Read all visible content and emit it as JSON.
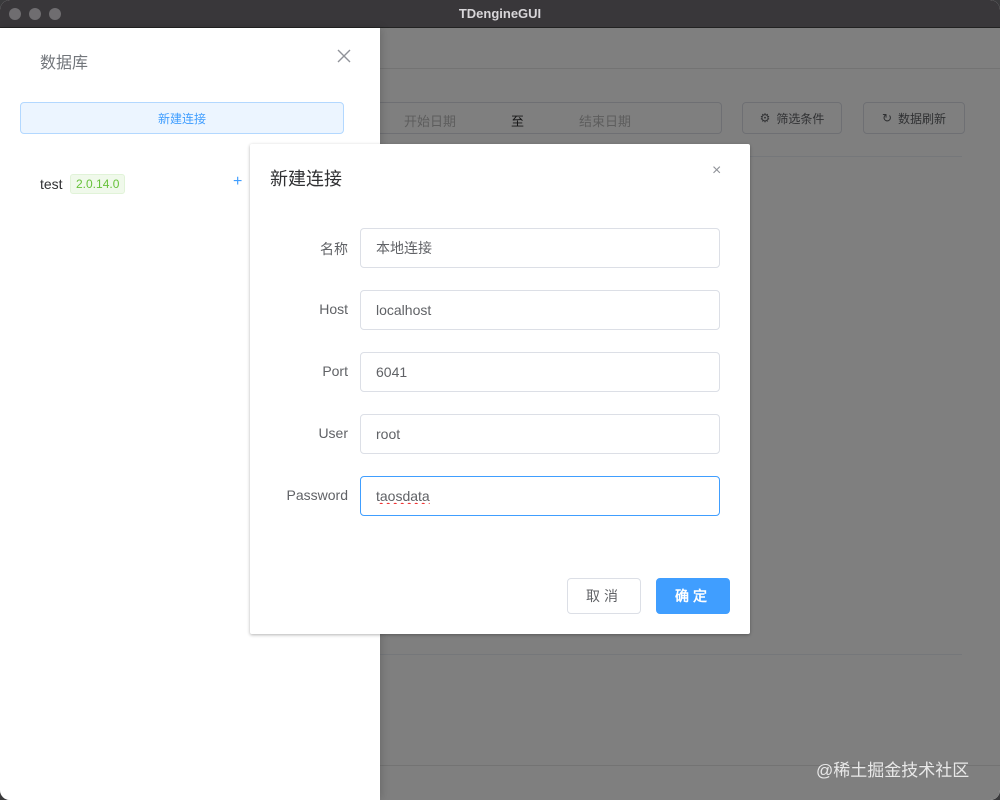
{
  "window": {
    "title": "TDengineGUI"
  },
  "toolbar": {
    "date_start_placeholder": "开始日期",
    "date_separator": "至",
    "date_end_placeholder": "结束日期",
    "filter_label": "筛选条件",
    "refresh_label": "数据刷新",
    "filter_icon": "gear-icon",
    "refresh_icon": "refresh-icon"
  },
  "drawer": {
    "title": "数据库",
    "close_icon": "close-icon",
    "new_connection_label": "新建连接",
    "connections": [
      {
        "name": "test",
        "version": "2.0.14.0",
        "add_icon": "+"
      }
    ]
  },
  "dialog": {
    "title": "新建连接",
    "close_icon": "×",
    "fields": {
      "name": {
        "label": "名称",
        "value": "本地连接"
      },
      "host": {
        "label": "Host",
        "value": "localhost"
      },
      "port": {
        "label": "Port",
        "value": "6041"
      },
      "user": {
        "label": "User",
        "value": "root"
      },
      "password": {
        "label": "Password",
        "value": "taosdata"
      }
    },
    "cancel_label": "取消",
    "ok_label": "确定"
  },
  "watermark": "@稀土掘金技术社区"
}
